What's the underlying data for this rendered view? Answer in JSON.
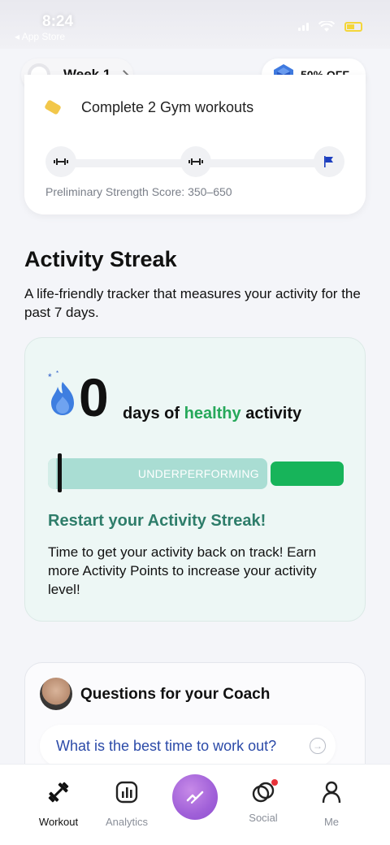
{
  "status_bar": {
    "time": "8:24",
    "back_label": "◂ App Store"
  },
  "top_nav": {
    "week_label": "Week 1",
    "sale_label": "50% OFF"
  },
  "gym_card": {
    "task_label": "Complete 2 Gym workouts",
    "score_label": "Preliminary Strength Score: 350–650"
  },
  "section": {
    "title": "Activity Streak",
    "description": "A life-friendly tracker that measures your activity for the past 7 days."
  },
  "streak_card": {
    "days_value": "0",
    "days_word": "days",
    "of_word": "of",
    "healthy_word": "healthy",
    "activity_word": "activity",
    "level_label": "UNDERPERFORMING",
    "heading": "Restart your Activity Streak!",
    "body": "Time to get your activity back on track! Earn more Activity Points to increase your activity level!"
  },
  "coach_card": {
    "title": "Questions for your Coach",
    "question": "What is the best time to work out?"
  },
  "tabs": [
    {
      "label": "Workout",
      "icon": "dumbbell-icon",
      "active": true
    },
    {
      "label": "Analytics",
      "icon": "chart-icon",
      "active": false
    },
    {
      "label": "Social",
      "icon": "rings-icon",
      "active": false
    },
    {
      "label": "Me",
      "icon": "person-icon",
      "active": false
    }
  ],
  "colors": {
    "accent_green": "#17b45a",
    "heading_teal": "#2e7d6a",
    "link_blue": "#2b4aa8",
    "center_purple": "#a060d8"
  }
}
